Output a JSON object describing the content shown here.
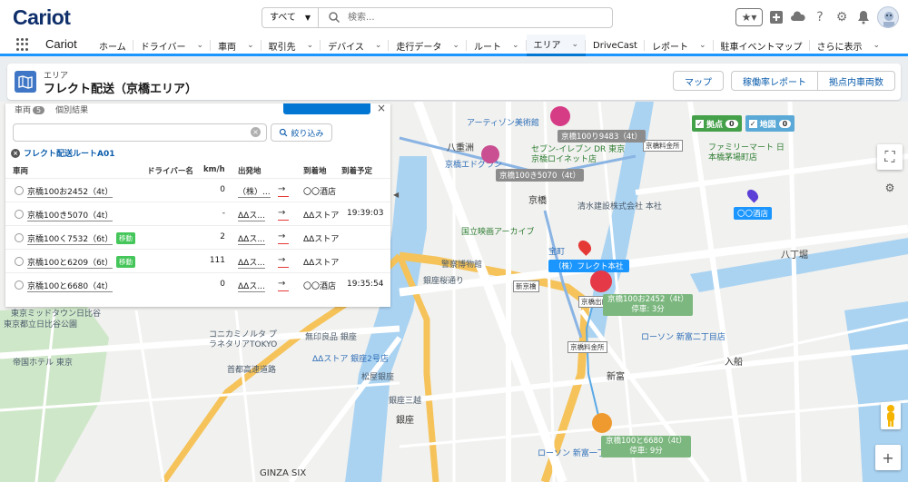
{
  "header": {
    "logo": "Cariot",
    "search": {
      "scope": "すべて",
      "placeholder": "検索..."
    }
  },
  "nav": {
    "app_name": "Cariot",
    "items": [
      {
        "label": "ホーム",
        "chevron": false
      },
      {
        "label": "ドライバー",
        "chevron": true
      },
      {
        "label": "車両",
        "chevron": true
      },
      {
        "label": "取引先",
        "chevron": true
      },
      {
        "label": "デバイス",
        "chevron": true
      },
      {
        "label": "走行データ",
        "chevron": true
      },
      {
        "label": "ルート",
        "chevron": true
      },
      {
        "label": "エリア",
        "chevron": true,
        "active": true
      },
      {
        "label": "DriveCast",
        "chevron": false
      },
      {
        "label": "レポート",
        "chevron": true
      },
      {
        "label": "駐車イベントマップ",
        "chevron": false
      },
      {
        "label": "さらに表示",
        "chevron": true
      }
    ]
  },
  "page": {
    "subtitle": "エリア",
    "title": "フレクト配送（京橋エリア）",
    "buttons": [
      "マップ",
      "稼働率レポート",
      "拠点内車両数"
    ]
  },
  "panel": {
    "tabs": [
      {
        "label": "車両",
        "count": "5"
      },
      {
        "label": "個別結果"
      }
    ],
    "filter_button": "絞り込み",
    "route_title": "フレクト配送ルートA01",
    "columns": [
      "車両",
      "ドライバー名",
      "km/h",
      "出発地",
      "到着地",
      "到着予定"
    ],
    "rows": [
      {
        "vehicle": "京橋100お2452（4t）",
        "badge": "",
        "driver": "",
        "speed": "0",
        "origin": "（株）...",
        "dest": "〇〇酒店",
        "eta": ""
      },
      {
        "vehicle": "京橋100き5070（4t）",
        "badge": "",
        "driver": "",
        "speed": "-",
        "origin": "ΔΔス...",
        "dest": "ΔΔストア",
        "eta": "19:39:03"
      },
      {
        "vehicle": "京橋100く7532（6t）",
        "badge": "移動",
        "driver": "",
        "speed": "2",
        "origin": "ΔΔス...",
        "dest": "ΔΔストア",
        "eta": ""
      },
      {
        "vehicle": "京橋100と6209（6t）",
        "badge": "移動",
        "driver": "",
        "speed": "111",
        "origin": "ΔΔス...",
        "dest": "ΔΔストア",
        "eta": ""
      },
      {
        "vehicle": "京橋100と6680（4t）",
        "badge": "",
        "driver": "",
        "speed": "0",
        "origin": "ΔΔス...",
        "dest": "〇〇酒店",
        "eta": "19:35:54"
      }
    ]
  },
  "map": {
    "legend": [
      {
        "label": "拠点",
        "count": "0",
        "color": "#45a04a"
      },
      {
        "label": "地図",
        "count": "0",
        "color": "#5aa9d6"
      }
    ],
    "vehicles": [
      {
        "label": "京橋100り9483（4t）",
        "color": "#d63c86"
      },
      {
        "label": "京橋100き5070（4t）",
        "color": "#c94f92"
      }
    ],
    "stops": [
      {
        "title": "京橋100お2452（4t）",
        "sub": "停車: 3分",
        "color": "#e53947"
      },
      {
        "title": "京橋100と6680（4t）",
        "sub": "停車: 9分",
        "color": "#ee9a2e"
      }
    ],
    "hq_label": "（株）フレクト本社",
    "shop_label": "〇〇酒店",
    "place_labels": [
      "アーティゾン美術館",
      "八重洲",
      "京橋エドグラン",
      "セブン-イレブン DR 東京京橋ロイネット店",
      "京橋",
      "清水建設株式会社 本社",
      "国立映画アーカイブ",
      "宝町",
      "警察博物館",
      "銀座桜通り",
      "東京都立日比谷公園",
      "東京ミッドタウン日比谷",
      "コニカミノルタ プラネタリアTOKYO",
      "無印良品 銀座",
      "帝国ホテル 東京",
      "ΔΔストア 銀座2号店",
      "松屋銀座",
      "銀座三越",
      "銀座",
      "新富",
      "入船",
      "八丁堀",
      "ローソン 新富二丁目店",
      "ファミリーマート 日本橋茅場町店",
      "GINZA SIX",
      "京橋料金所",
      "京橋出口",
      "首都高速道路",
      "京橋料金所",
      "新京橋",
      "ローソン 新富一丁目店"
    ]
  }
}
